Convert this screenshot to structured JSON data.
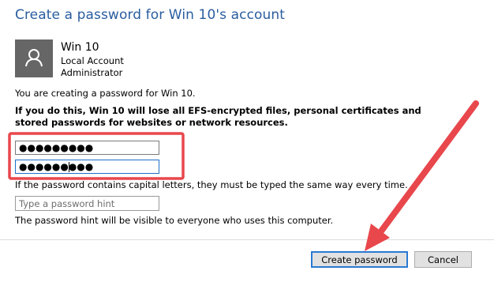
{
  "dialog": {
    "title": "Create a password for Win 10's account"
  },
  "account": {
    "name": "Win 10",
    "type": "Local Account",
    "role": "Administrator",
    "avatar_icon": "user-silhouette-icon"
  },
  "message": {
    "creating": "You are creating a password for Win 10.",
    "warning": "If you do this, Win 10 will lose all EFS-encrypted files, personal certificates and stored passwords for websites or network resources."
  },
  "fields": {
    "new_password": {
      "value": "●●●●●●●●●"
    },
    "confirm_password": {
      "value": "●●●●●●●●●"
    },
    "hint": {
      "value": "",
      "placeholder": "Type a password hint"
    }
  },
  "notes": {
    "caps": "If the password contains capital letters, they must be typed the same way every time.",
    "hint_visibility": "The password hint will be visible to everyone who uses this computer."
  },
  "buttons": {
    "create": "Create password",
    "cancel": "Cancel"
  },
  "annotations": {
    "highlight_color": "#e8474c",
    "arrow_color": "#e8474c"
  }
}
